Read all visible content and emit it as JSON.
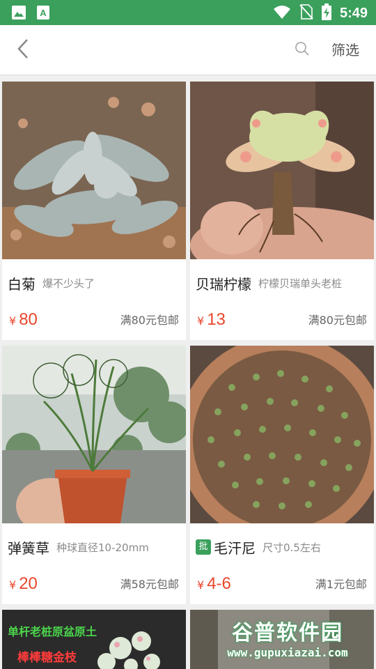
{
  "status_bar": {
    "time": "5:49",
    "icons": [
      "gallery-icon",
      "font-app-icon",
      "wifi-icon",
      "no-sim-icon",
      "battery-charging-icon"
    ]
  },
  "header": {
    "back_icon": "chevron-left-icon",
    "search_icon": "search-icon",
    "filter_label": "筛选"
  },
  "colors": {
    "brand_green": "#3aa05c",
    "price_red": "#e8462c"
  },
  "products": [
    {
      "name": "白菊",
      "subtitle": "爆不少头了",
      "currency": "¥",
      "price": "80",
      "shipping": "满80元包邮"
    },
    {
      "name": "贝瑞柠檬",
      "subtitle": "柠檬贝瑞单头老桩",
      "currency": "¥",
      "price": "13",
      "shipping": "满80元包邮"
    },
    {
      "name": "弹簧草",
      "subtitle": "种球直径10-20mm",
      "currency": "¥",
      "price": "20",
      "shipping": "满58元包邮"
    },
    {
      "badge": "批",
      "name": "毛汗尼",
      "subtitle": "尺寸0.5左右",
      "currency": "¥",
      "price": "4-6",
      "shipping": "满1元包邮"
    }
  ],
  "partial_cards": [
    {
      "overlay_line1": "单杆老桩原盆原土",
      "overlay_line2": "棒棒糖金枝"
    },
    {
      "watermark_line1": "谷普软件园",
      "watermark_line2": "www.gupuxiazai.com"
    }
  ]
}
